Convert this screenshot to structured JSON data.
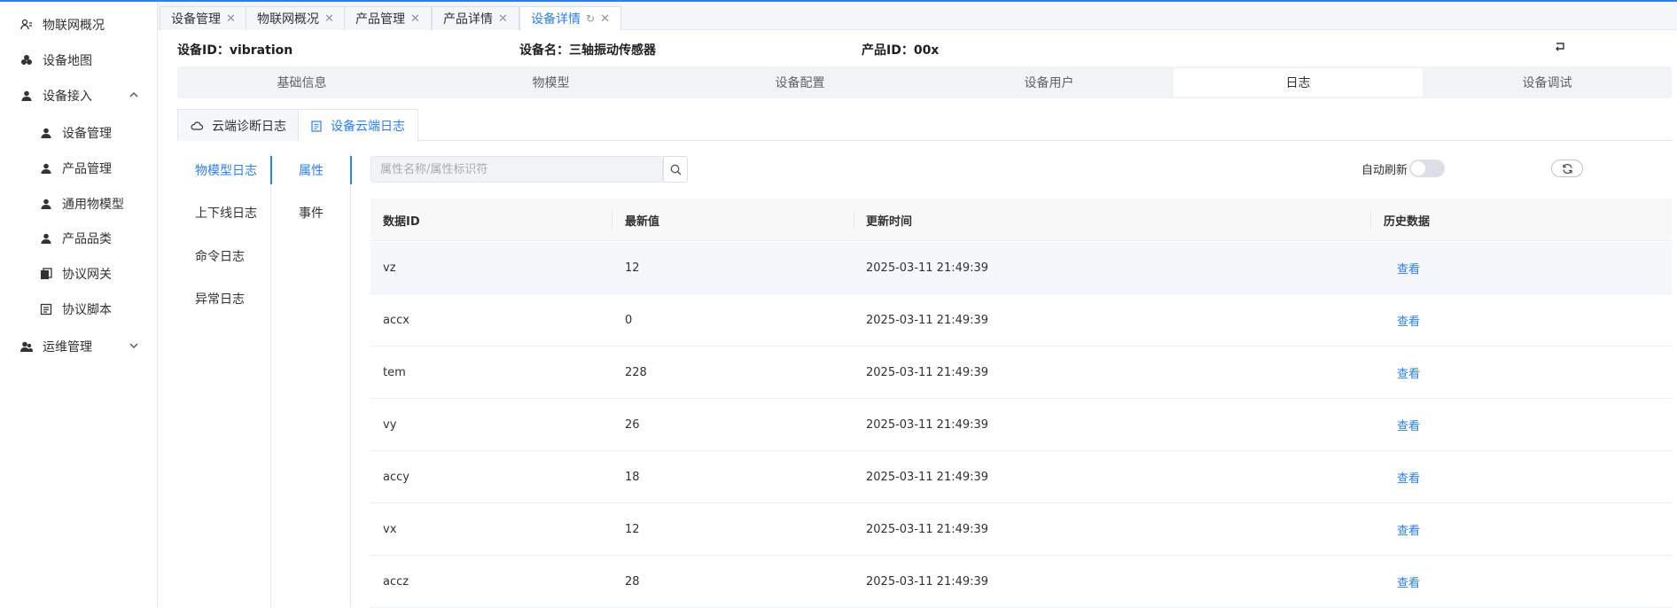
{
  "sidebar": {
    "items": [
      {
        "label": "物联网概况",
        "icon": "dashboard-icon"
      },
      {
        "label": "设备地图",
        "icon": "map-icon"
      },
      {
        "label": "设备接入",
        "icon": "user-icon",
        "expanded": true
      },
      {
        "label": "设备管理",
        "icon": "user-icon"
      },
      {
        "label": "产品管理",
        "icon": "user-icon"
      },
      {
        "label": "通用物模型",
        "icon": "user-icon"
      },
      {
        "label": "产品品类",
        "icon": "user-icon"
      },
      {
        "label": "协议网关",
        "icon": "gateway-icon"
      },
      {
        "label": "协议脚本",
        "icon": "script-icon"
      },
      {
        "label": "运维管理",
        "icon": "users-icon",
        "expanded": false
      }
    ]
  },
  "tabs": [
    {
      "label": "设备管理"
    },
    {
      "label": "物联网概况"
    },
    {
      "label": "产品管理"
    },
    {
      "label": "产品详情"
    },
    {
      "label": "设备详情",
      "active": true
    }
  ],
  "device": {
    "id_label": "设备ID：vibration",
    "name_label": "设备名：三轴振动传感器",
    "product_label": "产品ID：00x"
  },
  "segments": [
    "基础信息",
    "物模型",
    "设备配置",
    "设备用户",
    "日志",
    "设备调试"
  ],
  "active_segment": "日志",
  "log_tabs": [
    {
      "label": "云端诊断日志",
      "icon": "cloud-icon"
    },
    {
      "label": "设备云端日志",
      "icon": "device-log-icon",
      "active": true
    }
  ],
  "menu_primary": [
    "物模型日志",
    "上下线日志",
    "命令日志",
    "异常日志"
  ],
  "menu_secondary": [
    "属性",
    "事件"
  ],
  "search": {
    "placeholder": "属性名称/属性标识符"
  },
  "auto_refresh": {
    "label": "自动刷新",
    "on": false
  },
  "table": {
    "columns": [
      "数据ID",
      "最新值",
      "更新时间",
      "历史数据"
    ],
    "rows": [
      {
        "id": "vz",
        "value": "12",
        "time": "2025-03-11 21:49:39",
        "action": "查看"
      },
      {
        "id": "accx",
        "value": "0",
        "time": "2025-03-11 21:49:39",
        "action": "查看"
      },
      {
        "id": "tem",
        "value": "228",
        "time": "2025-03-11 21:49:39",
        "action": "查看"
      },
      {
        "id": "vy",
        "value": "26",
        "time": "2025-03-11 21:49:39",
        "action": "查看"
      },
      {
        "id": "accy",
        "value": "18",
        "time": "2025-03-11 21:49:39",
        "action": "查看"
      },
      {
        "id": "vx",
        "value": "12",
        "time": "2025-03-11 21:49:39",
        "action": "查看"
      },
      {
        "id": "accz",
        "value": "28",
        "time": "2025-03-11 21:49:39",
        "action": "查看"
      }
    ]
  },
  "colors": {
    "accent": "#2a7fff"
  }
}
